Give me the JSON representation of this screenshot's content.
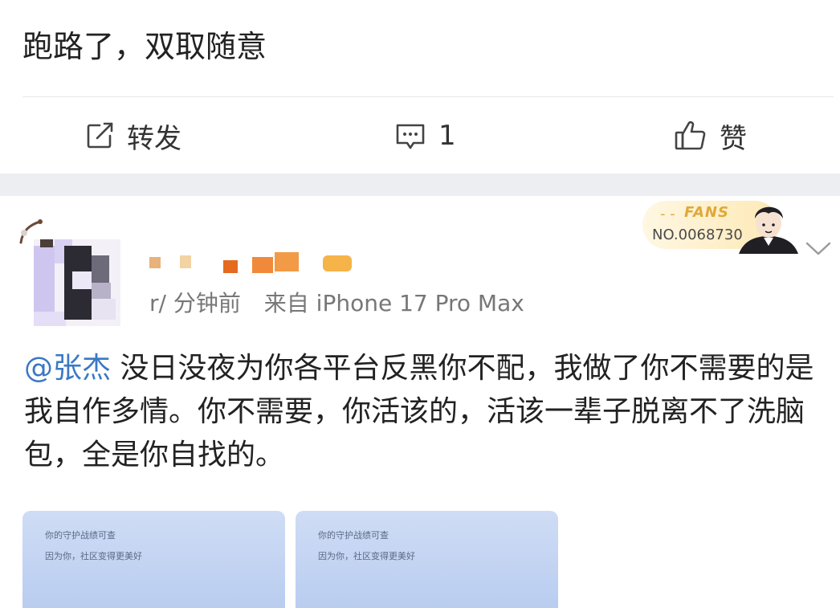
{
  "top_post": {
    "text": "跑路了，双取随意"
  },
  "actions": {
    "forward_label": "转发",
    "comment_count": "1",
    "like_label": "赞"
  },
  "comment": {
    "time": "r/ 分钟前",
    "source": "来自 iPhone 17 Pro Max",
    "mention": "@张杰",
    "body": " 没日没夜为你各平台反黑你不配，我做了你不需要的是我自作多情。你不需要，你活该的，活该一辈子脱离不了洗脑包，全是你自找的。",
    "fans_badge": {
      "word": "FANS",
      "dash": "- -",
      "number": "NO.0068730"
    },
    "images": [
      {
        "line1": "你的守护战绩可查",
        "line2": "因为你，社区变得更美好"
      },
      {
        "line1": "你的守护战绩可查",
        "line2": "因为你，社区变得更美好"
      }
    ]
  },
  "colors": {
    "mention": "#3b78c5",
    "fans_gold": "#e0a83a",
    "image_blue": "#c3d4f2"
  }
}
